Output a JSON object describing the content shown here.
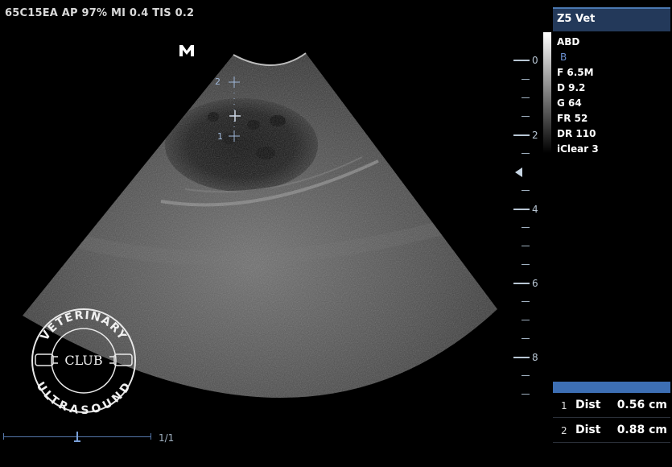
{
  "header": {
    "text": "65C15EA  AP 97%  MI 0.4  TIS 0.2"
  },
  "orientation_marker": "M",
  "probe": {
    "name": "Z5 Vet"
  },
  "params": {
    "preset": "ABD",
    "mode": "B",
    "freq": "F 6.5M",
    "depth": "D 9.2",
    "gain": "G 64",
    "frame_rate": "FR 52",
    "dynamic_range": "DR 110",
    "iclear": "iClear 3"
  },
  "depth_scale": {
    "labels": [
      "0",
      "2",
      "4",
      "6",
      "8"
    ]
  },
  "calipers": {
    "point1": "1",
    "point2": "2"
  },
  "measurements": [
    {
      "index": "1",
      "label": "Dist",
      "value": "0.56 cm"
    },
    {
      "index": "2",
      "label": "Dist",
      "value": "0.88 cm"
    }
  ],
  "cine": {
    "frame": "1/1"
  },
  "logo": {
    "top": "VETERINARY",
    "center": "CLUB",
    "bottom": "ULTRASOUND"
  },
  "colors": {
    "probe_header_bg": "#23395a",
    "measure_header_bg": "#3d6fb4",
    "accent_blue": "#6a8fd0"
  }
}
